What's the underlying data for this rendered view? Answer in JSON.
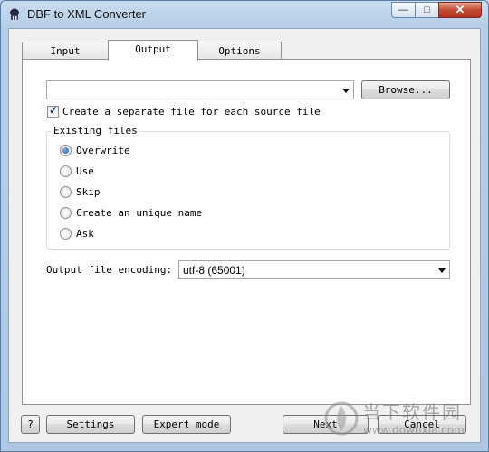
{
  "window": {
    "title": "DBF to XML Converter",
    "minimize": "—",
    "maximize": "□",
    "close": "✕"
  },
  "tabs": [
    {
      "label": "Input",
      "active": false
    },
    {
      "label": "Output",
      "active": true
    },
    {
      "label": "Options",
      "active": false
    }
  ],
  "output": {
    "path_value": "",
    "browse_label": "Browse...",
    "separate_file_label": "Create a separate file for each source file",
    "separate_file_checked": true,
    "existing_files": {
      "legend": "Existing files",
      "options": [
        {
          "label": "Overwrite",
          "selected": true
        },
        {
          "label": "Use",
          "selected": false
        },
        {
          "label": "Skip",
          "selected": false
        },
        {
          "label": "Create an unique name",
          "selected": false
        },
        {
          "label": "Ask",
          "selected": false
        }
      ]
    },
    "encoding_label": "Output file encoding:",
    "encoding_value": "utf-8 (65001)"
  },
  "footer": {
    "help_label": "?",
    "settings_label": "Settings",
    "expert_mode_label": "Expert mode",
    "next_label": "Next",
    "cancel_label": "Cancel"
  },
  "watermark": {
    "text": "当下软件园",
    "url": "www.downxia.com"
  }
}
